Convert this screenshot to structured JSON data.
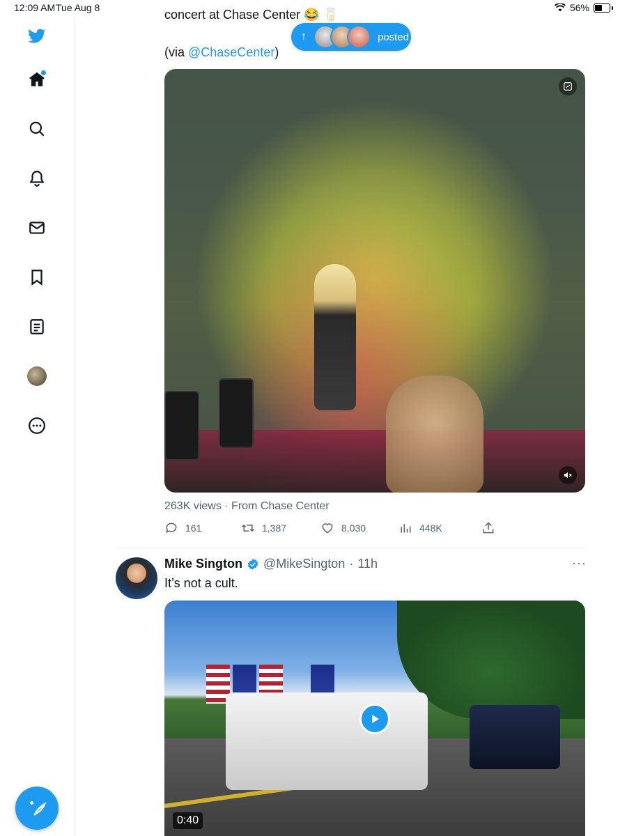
{
  "status_bar": {
    "time": "12:09 AM",
    "date": "Tue Aug 8",
    "battery": "56%"
  },
  "nav": {
    "items": [
      {
        "name": "twitter-logo-icon"
      },
      {
        "name": "home-icon"
      },
      {
        "name": "search-icon"
      },
      {
        "name": "notifications-icon"
      },
      {
        "name": "messages-icon"
      },
      {
        "name": "bookmarks-icon"
      },
      {
        "name": "lists-icon"
      },
      {
        "name": "profile-avatar"
      },
      {
        "name": "more-icon"
      }
    ],
    "compose_icon": "compose-feather-icon"
  },
  "new_posts_pill": {
    "label": "posted",
    "arrow": "↑"
  },
  "tweet1": {
    "text_partial": "concert at Chase Center 😂 🥛",
    "via_prefix": "(via ",
    "via_link": "@ChaseCenter",
    "via_suffix": ")",
    "views_line": "263K views · From Chase Center",
    "actions": {
      "replies": "161",
      "retweets": "1,387",
      "likes": "8,030",
      "views": "448K"
    }
  },
  "tweet2": {
    "name": "Mike Sington",
    "handle": "@MikeSington",
    "separator": "·",
    "time": "11h",
    "more": "···",
    "text": "It’s not a cult.",
    "video_duration": "0:40"
  },
  "colors": {
    "accent": "#1d9bf0",
    "secondary_text": "#536471"
  }
}
